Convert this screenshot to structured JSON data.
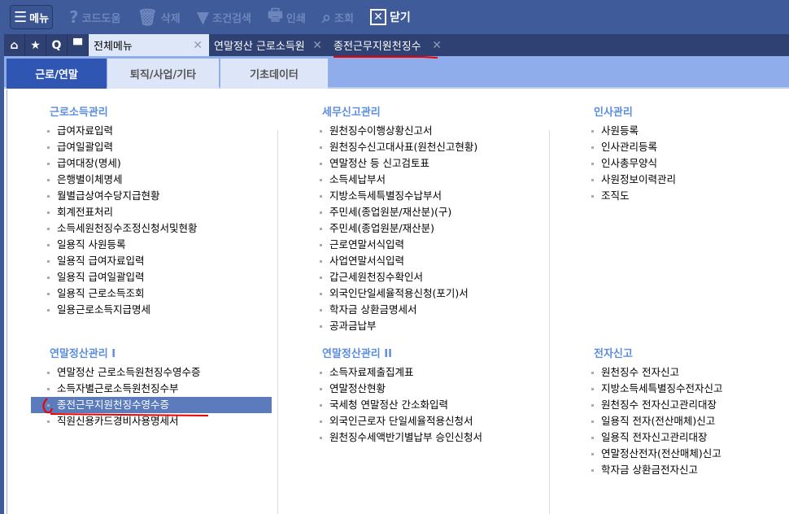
{
  "toolbar": {
    "menu": "메뉴",
    "help": "코드도움",
    "delete": "삭제",
    "filter": "조건검색",
    "print": "인쇄",
    "search": "조회",
    "close": "닫기"
  },
  "tabs": [
    {
      "label": "전체메뉴"
    },
    {
      "label": "연말정산 근로소득원"
    },
    {
      "label": "종전근무지원천징수"
    }
  ],
  "subtabs": [
    "근로/연말",
    "퇴직/사업/기타",
    "기초데이터"
  ],
  "sections": [
    {
      "title": "근로소득관리",
      "items": [
        "급여자료입력",
        "급여일괄입력",
        "급여대장(명세)",
        "은행별이체명세",
        "월별급상여수당지급현황",
        "회계전표처리",
        "소득세원천징수조정신청서및현황",
        "일용직 사원등록",
        "일용직 급여자료입력",
        "일용직 급여일괄입력",
        "일용직 근로소득조회",
        "일용근로소득지급명세"
      ]
    },
    {
      "title": "세무신고관리",
      "items": [
        "원천징수이행상황신고서",
        "원천징수신고대사표(원천신고현황)",
        "연말정산 등 신고검토표",
        "소득세납부서",
        "지방소득세특별징수납부서",
        "주민세(종업원분/재산분)(구)",
        "주민세(종업원분/재산분)",
        "근로연말서식입력",
        "사업연말서식입력",
        "갑근세원천징수확인서",
        "외국인단일세율적용신청(포기)서",
        "학자금 상환금명세서",
        "공과금납부"
      ]
    },
    {
      "title": "인사관리",
      "items": [
        "사원등록",
        "인사관리등록",
        "인사총무양식",
        "사원정보이력관리",
        "조직도"
      ]
    },
    {
      "title": "연말정산관리 I",
      "items": [
        "연말정산 근로소득원천징수영수증",
        "소득자별근로소득원천징수부",
        "종전근무지원천징수영수증",
        "직원신용카드경비사용명세서"
      ]
    },
    {
      "title": "연말정산관리 II",
      "items": [
        "소득자료제출집계표",
        "연말정산현황",
        "국세청 연말정산 간소화입력",
        "외국인근로자 단일세율적용신청서",
        "원천징수세액반기별납부 승인신청서"
      ]
    },
    {
      "title": "전자신고",
      "items": [
        "원천징수 전자신고",
        "지방소득세특별징수전자신고",
        "원천징수 전자신고관리대장",
        "일용직 전자(전산매체)신고",
        "일용직 전자신고관리대장",
        "연말정산전자(전산매체)신고",
        "학자금 상환금전자신고"
      ]
    }
  ],
  "selected_item": "종전근무지원천징수영수증"
}
